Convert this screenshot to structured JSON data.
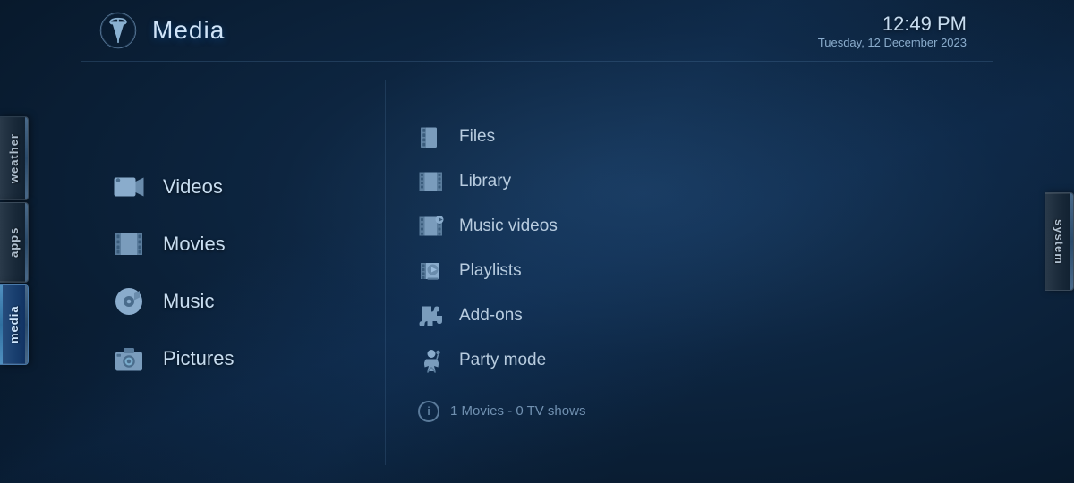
{
  "header": {
    "title": "Media",
    "time": "12:49 PM",
    "date": "Tuesday, 12 December 2023"
  },
  "left_tabs": [
    {
      "id": "weather",
      "label": "weather",
      "active": false
    },
    {
      "id": "apps",
      "label": "apps",
      "active": false
    },
    {
      "id": "media",
      "label": "media",
      "active": true
    }
  ],
  "right_tabs": [
    {
      "id": "system",
      "label": "system",
      "active": false
    }
  ],
  "main_menu": [
    {
      "id": "videos",
      "label": "Videos",
      "icon": "video-camera"
    },
    {
      "id": "movies",
      "label": "Movies",
      "icon": "film-strip"
    },
    {
      "id": "music",
      "label": "Music",
      "icon": "music-disc"
    },
    {
      "id": "pictures",
      "label": "Pictures",
      "icon": "camera"
    }
  ],
  "sub_menu": [
    {
      "id": "files",
      "label": "Files",
      "icon": "film-icon"
    },
    {
      "id": "library",
      "label": "Library",
      "icon": "film-icon2"
    },
    {
      "id": "music-videos",
      "label": "Music videos",
      "icon": "film-icon3"
    },
    {
      "id": "playlists",
      "label": "Playlists",
      "icon": "playlist-icon"
    },
    {
      "id": "add-ons",
      "label": "Add-ons",
      "icon": "puzzle-icon"
    },
    {
      "id": "party-mode",
      "label": "Party mode",
      "icon": "party-icon"
    }
  ],
  "info": {
    "text": "1 Movies  -  0 TV shows"
  }
}
